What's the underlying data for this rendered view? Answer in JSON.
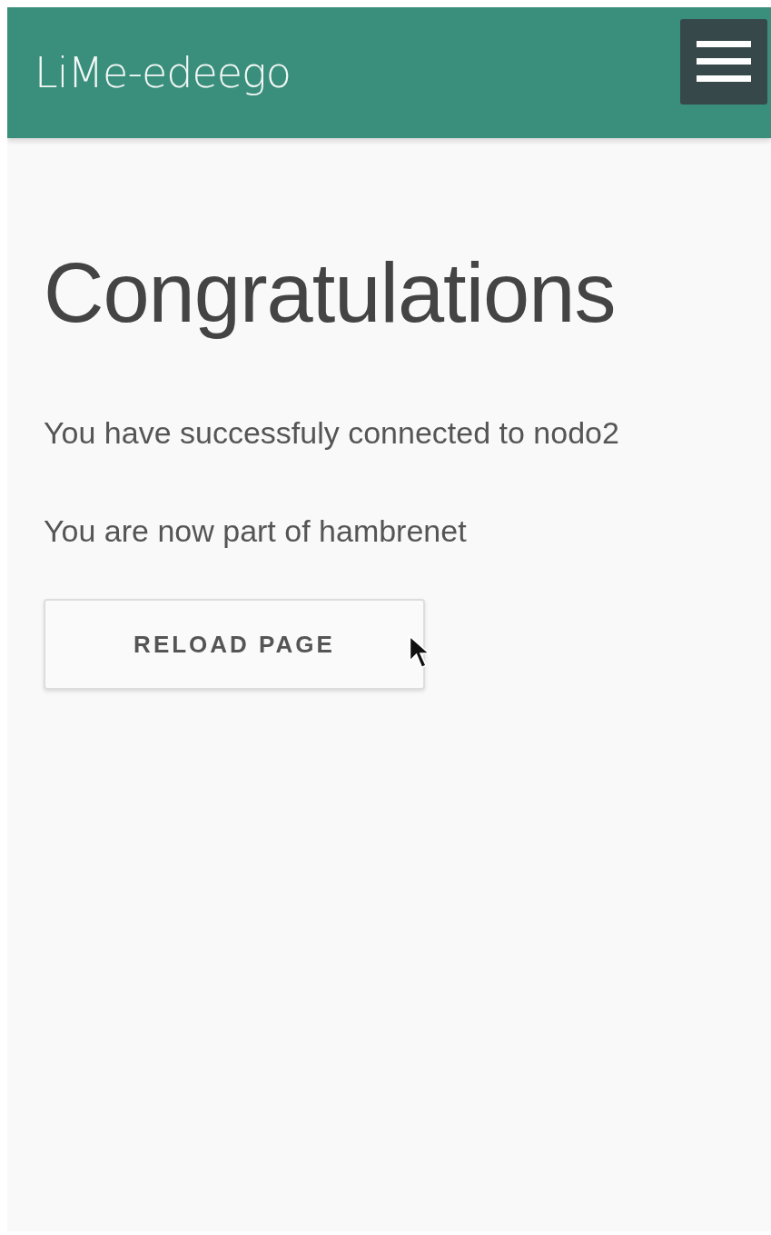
{
  "header": {
    "title": "LiMe-edeego"
  },
  "content": {
    "heading": "Congratulations",
    "paragraphs": [
      "You have successfuly connected to nodo2",
      "You are now part of hambrenet"
    ],
    "button": "RELOAD PAGE"
  }
}
